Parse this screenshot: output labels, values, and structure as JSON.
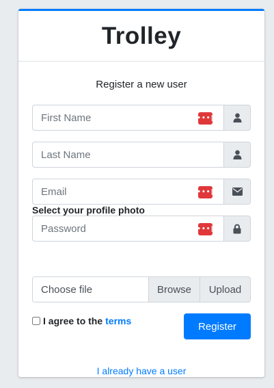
{
  "brand": "Trolley",
  "subtitle": "Register a new user",
  "fields": {
    "first_name": {
      "placeholder": "First Name",
      "value": "",
      "icon": "user-icon"
    },
    "last_name": {
      "placeholder": "Last Name",
      "value": "",
      "icon": "user-icon"
    },
    "email": {
      "placeholder": "Email",
      "value": "",
      "icon": "envelope-icon"
    },
    "password": {
      "placeholder": "Password",
      "value": "",
      "icon": "lock-icon"
    }
  },
  "password_manager_badge": "•••|",
  "photo": {
    "label": "Select your profile photo",
    "file_placeholder": "Choose file",
    "browse_label": "Browse",
    "upload_label": "Upload"
  },
  "agree": {
    "text": "I agree to the",
    "link": "terms"
  },
  "register_label": "Register",
  "already_user_link": "I already have a user",
  "colors": {
    "accent": "#007bff",
    "badge": "#e0383a",
    "background": "#e9ecef"
  }
}
